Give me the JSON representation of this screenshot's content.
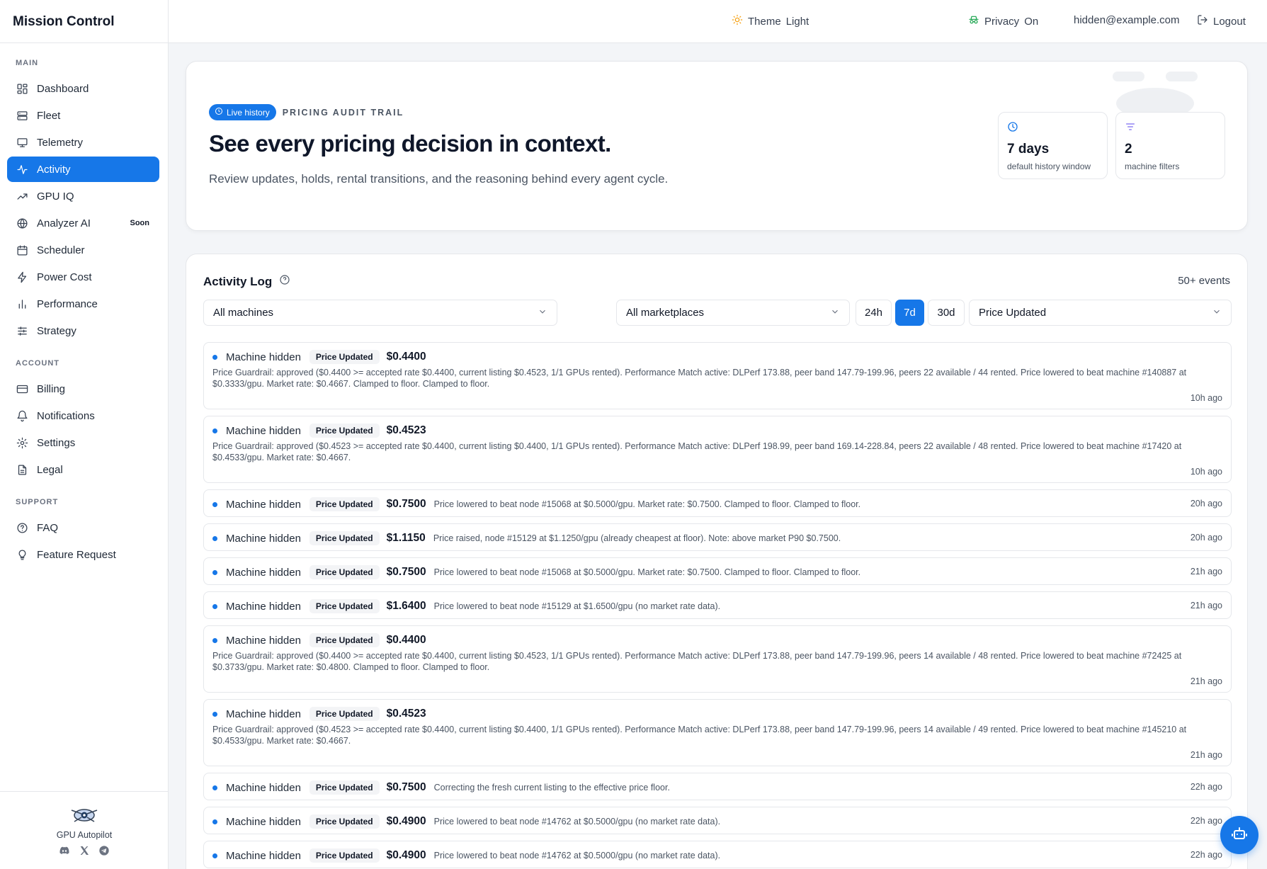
{
  "app": {
    "title": "Mission Control"
  },
  "sidebar": {
    "sections": [
      {
        "label": "MAIN",
        "items": [
          {
            "label": "Dashboard",
            "icon": "dashboard-icon"
          },
          {
            "label": "Fleet",
            "icon": "server-icon"
          },
          {
            "label": "Telemetry",
            "icon": "monitor-icon"
          },
          {
            "label": "Activity",
            "icon": "activity-icon",
            "active": true
          },
          {
            "label": "GPU IQ",
            "icon": "trending-up-icon"
          },
          {
            "label": "Analyzer AI",
            "icon": "globe-icon",
            "badge": "Soon"
          },
          {
            "label": "Scheduler",
            "icon": "calendar-icon"
          },
          {
            "label": "Power Cost",
            "icon": "bolt-icon"
          },
          {
            "label": "Performance",
            "icon": "bar-chart-icon"
          },
          {
            "label": "Strategy",
            "icon": "sliders-icon"
          }
        ]
      },
      {
        "label": "ACCOUNT",
        "items": [
          {
            "label": "Billing",
            "icon": "credit-card-icon"
          },
          {
            "label": "Notifications",
            "icon": "bell-icon"
          },
          {
            "label": "Settings",
            "icon": "gear-icon"
          },
          {
            "label": "Legal",
            "icon": "document-icon"
          }
        ]
      },
      {
        "label": "SUPPORT",
        "items": [
          {
            "label": "FAQ",
            "icon": "help-icon"
          },
          {
            "label": "Feature Request",
            "icon": "lightbulb-icon"
          }
        ]
      }
    ],
    "footer": {
      "title": "GPU Autopilot"
    }
  },
  "topbar": {
    "theme_label": "Theme",
    "theme_value": "Light",
    "privacy_label": "Privacy",
    "privacy_value": "On",
    "email": "hidden@example.com",
    "logout_label": "Logout"
  },
  "hero": {
    "badge": "Live history",
    "eyebrow": "PRICING AUDIT TRAIL",
    "title": "See every pricing decision in context.",
    "subtitle": "Review updates, holds, rental transitions, and the reasoning behind every agent cycle.",
    "stats": [
      {
        "value": "7 days",
        "label": "default history window",
        "icon": "clock-icon"
      },
      {
        "value": "2",
        "label": "machine filters",
        "icon": "filter-icon"
      }
    ]
  },
  "log": {
    "title": "Activity Log",
    "events_count": "50+ events",
    "filters": {
      "machine": "All machines",
      "marketplace": "All marketplaces",
      "ranges": [
        "24h",
        "7d",
        "30d"
      ],
      "active_range": "7d",
      "event_type": "Price Updated"
    },
    "events": [
      {
        "machine": "Machine hidden",
        "type": "Price Updated",
        "price": "$0.4400",
        "expanded": true,
        "time": "10h ago",
        "reason": "Price Guardrail: approved ($0.4400 >= accepted rate $0.4400, current listing $0.4523, 1/1 GPUs rented). Performance Match active: DLPerf 173.88, peer band 147.79-199.96, peers 22 available / 44 rented. Price lowered to beat machine #140887 at $0.3333/gpu. Market rate: $0.4667. Clamped to floor. Clamped to floor."
      },
      {
        "machine": "Machine hidden",
        "type": "Price Updated",
        "price": "$0.4523",
        "expanded": true,
        "time": "10h ago",
        "reason": "Price Guardrail: approved ($0.4523 >= accepted rate $0.4400, current listing $0.4400, 1/1 GPUs rented). Performance Match active: DLPerf 198.99, peer band 169.14-228.84, peers 22 available / 48 rented. Price lowered to beat machine #17420 at $0.4533/gpu. Market rate: $0.4667."
      },
      {
        "machine": "Machine hidden",
        "type": "Price Updated",
        "price": "$0.7500",
        "expanded": false,
        "time": "20h ago",
        "reason": "Price lowered to beat node #15068 at $0.5000/gpu. Market rate: $0.7500. Clamped to floor. Clamped to floor."
      },
      {
        "machine": "Machine hidden",
        "type": "Price Updated",
        "price": "$1.1150",
        "expanded": false,
        "time": "20h ago",
        "reason": "Price raised, node #15129 at $1.1250/gpu (already cheapest at floor). Note: above market P90 $0.7500."
      },
      {
        "machine": "Machine hidden",
        "type": "Price Updated",
        "price": "$0.7500",
        "expanded": false,
        "time": "21h ago",
        "reason": "Price lowered to beat node #15068 at $0.5000/gpu. Market rate: $0.7500. Clamped to floor. Clamped to floor."
      },
      {
        "machine": "Machine hidden",
        "type": "Price Updated",
        "price": "$1.6400",
        "expanded": false,
        "time": "21h ago",
        "reason": "Price lowered to beat node #15129 at $1.6500/gpu (no market rate data)."
      },
      {
        "machine": "Machine hidden",
        "type": "Price Updated",
        "price": "$0.4400",
        "expanded": true,
        "time": "21h ago",
        "reason": "Price Guardrail: approved ($0.4400 >= accepted rate $0.4400, current listing $0.4523, 1/1 GPUs rented). Performance Match active: DLPerf 173.88, peer band 147.79-199.96, peers 14 available / 48 rented. Price lowered to beat machine #72425 at $0.3733/gpu. Market rate: $0.4800. Clamped to floor. Clamped to floor."
      },
      {
        "machine": "Machine hidden",
        "type": "Price Updated",
        "price": "$0.4523",
        "expanded": true,
        "time": "21h ago",
        "reason": "Price Guardrail: approved ($0.4523 >= accepted rate $0.4400, current listing $0.4400, 1/1 GPUs rented). Performance Match active: DLPerf 173.88, peer band 147.79-199.96, peers 14 available / 49 rented. Price lowered to beat machine #145210 at $0.4533/gpu. Market rate: $0.4667."
      },
      {
        "machine": "Machine hidden",
        "type": "Price Updated",
        "price": "$0.7500",
        "expanded": false,
        "time": "22h ago",
        "reason": "Correcting the fresh current listing to the effective price floor."
      },
      {
        "machine": "Machine hidden",
        "type": "Price Updated",
        "price": "$0.4900",
        "expanded": false,
        "time": "22h ago",
        "reason": "Price lowered to beat node #14762 at $0.5000/gpu (no market rate data)."
      },
      {
        "machine": "Machine hidden",
        "type": "Price Updated",
        "price": "$0.4900",
        "expanded": false,
        "time": "22h ago",
        "reason": "Price lowered to beat node #14762 at $0.5000/gpu (no market rate data)."
      }
    ]
  },
  "colors": {
    "accent": "#1677e8",
    "text": "#1f2937",
    "muted": "#4b5563",
    "border": "#e5e7eb",
    "background": "#f3f5f8"
  }
}
